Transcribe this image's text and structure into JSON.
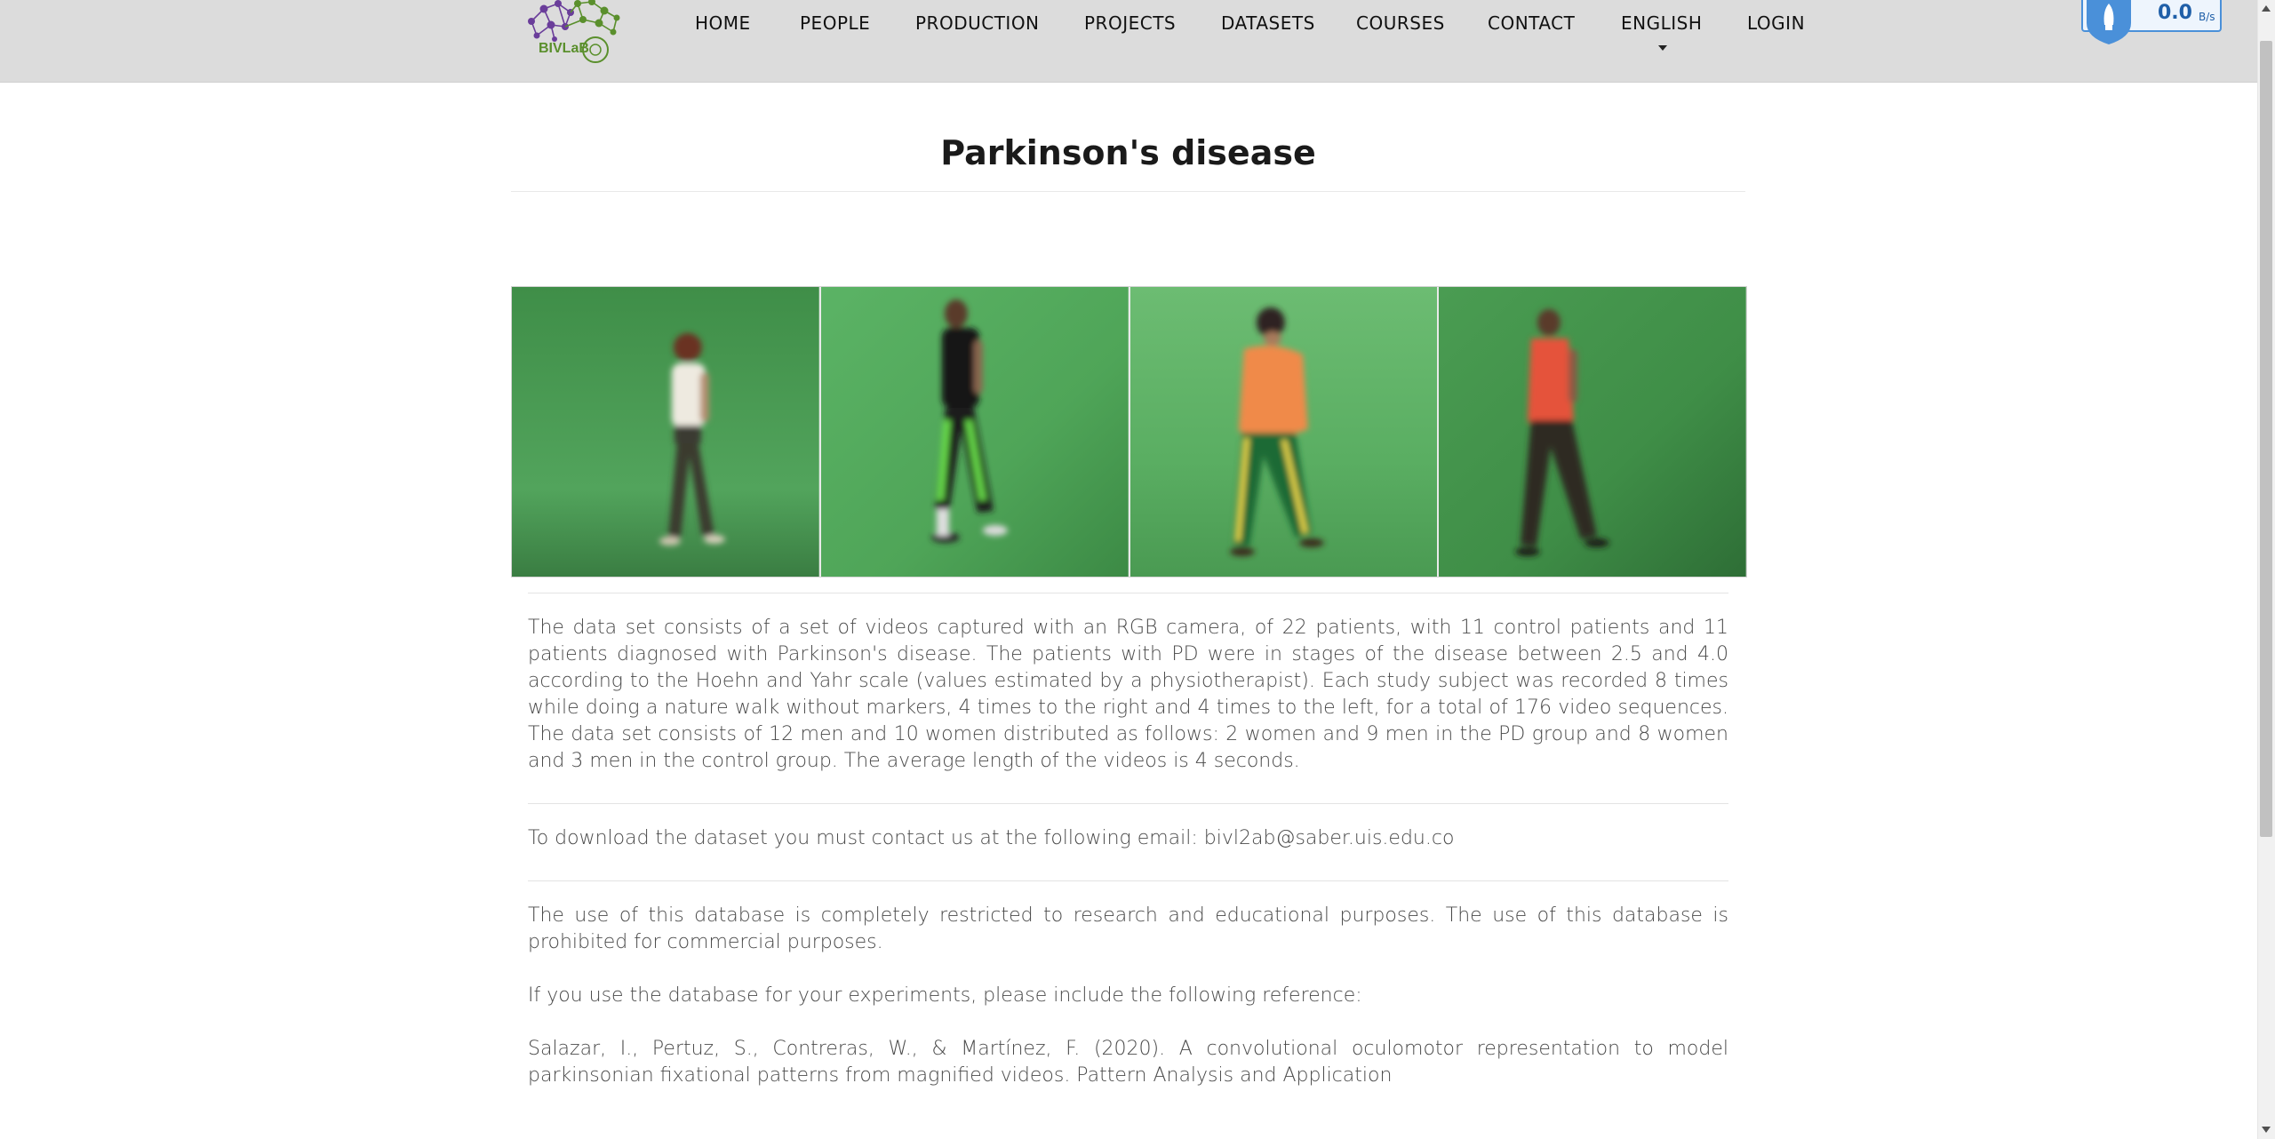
{
  "nav": {
    "logo_text": "BIVLaB",
    "items": [
      "HOME",
      "PEOPLE",
      "PRODUCTION",
      "PROJECTS",
      "DATASETS",
      "COURSES",
      "CONTACT",
      "ENGLISH",
      "LOGIN"
    ]
  },
  "speed_widget": {
    "value": "0.0",
    "unit": "B/s"
  },
  "page": {
    "title": "Parkinson's disease"
  },
  "gallery": {
    "images": [
      {
        "icon": "walking-woman-white-shirt-photo"
      },
      {
        "icon": "walking-man-black-shirt-photo"
      },
      {
        "icon": "walking-woman-orange-shirt-photo"
      },
      {
        "icon": "walking-man-red-shirt-photo"
      }
    ]
  },
  "content": {
    "description": "The data set consists of a set of videos captured with an RGB camera, of 22 patients, with 11 control patients and 11 patients diagnosed with Parkinson's disease. The patients with PD were in stages of the disease between 2.5 and 4.0 according to the Hoehn and Yahr scale (values estimated by a physiotherapist). Each study subject was recorded 8 times while doing a nature walk without markers, 4 times to the right and 4 times to the left, for a total of 176 video sequences. The data set consists of 12 men and 10 women distributed as follows: 2 women and 9 men in the PD group and 8 women and 3 men in the control group. The average length of the videos is 4 seconds.",
    "download": "To download the dataset you must contact us at the following email: bivl2ab@saber.uis.edu.co",
    "usage": "The use of this database is completely restricted to research and educational purposes. The use of this database is prohibited for commercial purposes.",
    "reference_intro": "If you use the database for your experiments, please include the following reference:",
    "reference": "Salazar, I., Pertuz, S., Contreras, W., & Martínez, F. (2020). A convolutional oculomotor representation to model parkinsonian fixational patterns from magnified videos. Pattern Analysis and Application"
  },
  "colors": {
    "navbar_bg": "#dcdcdc",
    "logo_purple": "#6a3d9a",
    "logo_green": "#5a8f2c",
    "photo_green": "#4f9e58",
    "speed_blue": "#1f5fa8"
  }
}
